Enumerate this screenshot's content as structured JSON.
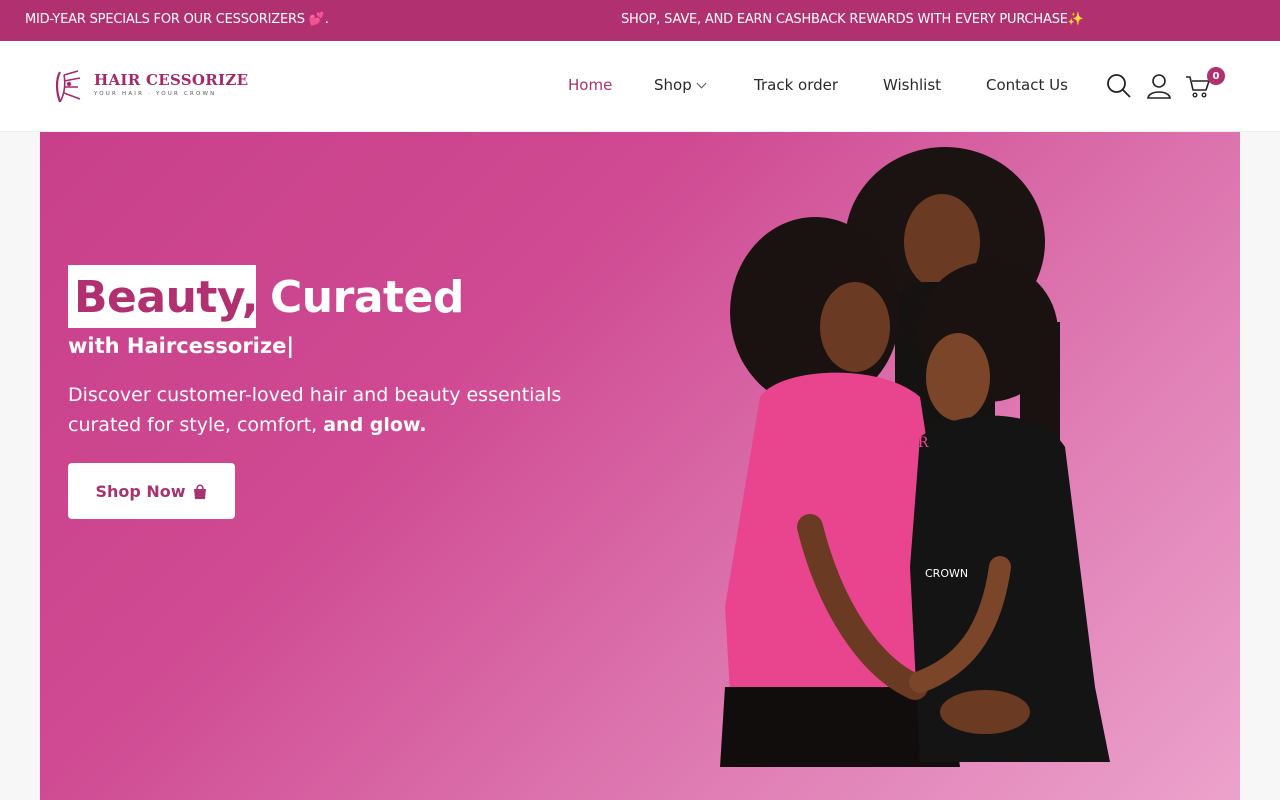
{
  "announcement": {
    "left": "MID-YEAR SPECIALS FOR OUR CESSORIZERS 💕.",
    "right": "SHOP, SAVE, AND EARN CASHBACK REWARDS WITH EVERY PURCHASE✨"
  },
  "brand": {
    "name": "HAIR CESSORIZE",
    "tagline": "YOUR HAIR · YOUR CROWN"
  },
  "nav": {
    "home": "Home",
    "shop": "Shop",
    "track": "Track order",
    "wishlist": "Wishlist",
    "contact": "Contact Us"
  },
  "cart": {
    "count": "0"
  },
  "hero": {
    "highlight": "Beauty,",
    "title_rest": "Curated",
    "subtitle": "with Haircessorize|",
    "description_main": "Discover customer-loved hair and beauty essentials curated for style, comfort, ",
    "description_bold": "and glow.",
    "cta": "Shop Now",
    "photo_shirt_text_1": "HAIR",
    "photo_shirt_text_2": "CROWN"
  },
  "colors": {
    "brand": "#b1306f",
    "hero_start": "#c8408a",
    "hero_end": "#eca2cb",
    "active_nav": "#a8336f"
  },
  "icons": [
    "search-icon",
    "user-icon",
    "cart-icon",
    "shopping-bag-icon",
    "chevron-down-icon",
    "logo-mark-icon"
  ]
}
